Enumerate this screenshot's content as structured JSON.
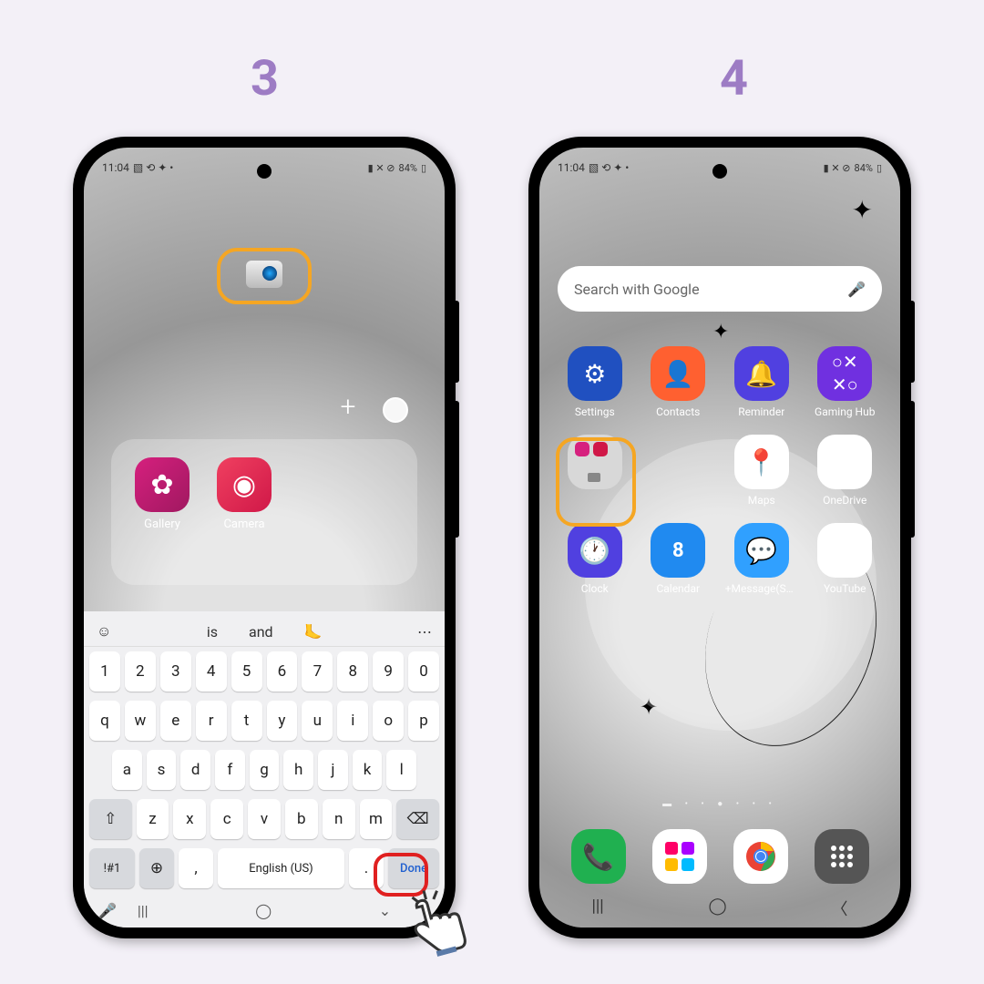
{
  "steps": {
    "left": "3",
    "right": "4"
  },
  "statusbar": {
    "time": "11:04",
    "battery": "84%"
  },
  "left": {
    "folder_apps": [
      {
        "label": "Gallery"
      },
      {
        "label": "Camera"
      }
    ],
    "suggestions": {
      "s1": "is",
      "s2": "and"
    },
    "keyboard": {
      "row1": [
        "1",
        "2",
        "3",
        "4",
        "5",
        "6",
        "7",
        "8",
        "9",
        "0"
      ],
      "row2": [
        "q",
        "w",
        "e",
        "r",
        "t",
        "y",
        "u",
        "i",
        "o",
        "p"
      ],
      "row3": [
        "a",
        "s",
        "d",
        "f",
        "g",
        "h",
        "j",
        "k",
        "l"
      ],
      "row4": [
        "z",
        "x",
        "c",
        "v",
        "b",
        "n",
        "m"
      ],
      "sym": "!#1",
      "space": "English (US)",
      "comma": ",",
      "period": ".",
      "done": "Done"
    }
  },
  "right": {
    "search_placeholder": "Search with Google",
    "apps": {
      "settings": "Settings",
      "contacts": "Contacts",
      "reminder": "Reminder",
      "gaming": "Gaming Hub",
      "maps": "Maps",
      "onedrive": "OneDrive",
      "clock": "Clock",
      "calendar": "Calendar",
      "calendar_day": "8",
      "message": "+Message(SM...",
      "youtube": "YouTube"
    },
    "page_dots": "▬  •  •  ●  •  •  •"
  }
}
